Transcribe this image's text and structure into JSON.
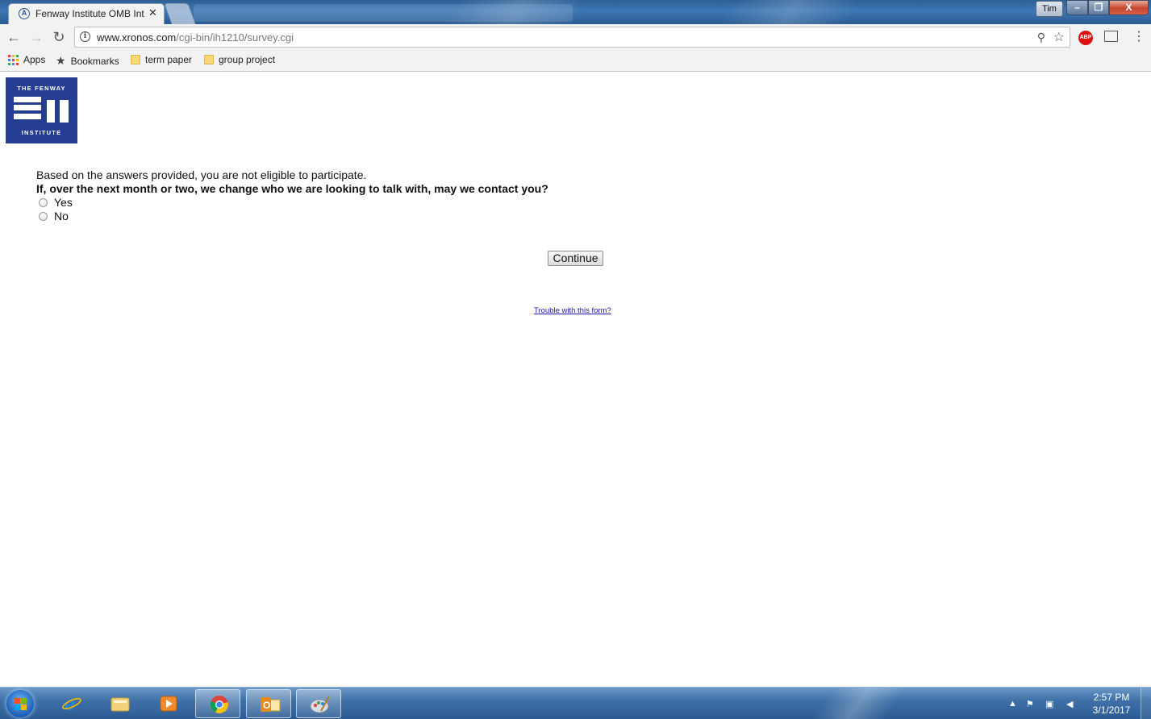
{
  "browser": {
    "active_tab_title": "Fenway Institute OMB Int",
    "tab_close_glyph": "✕",
    "profile_name": "Tim",
    "window_buttons": {
      "minimize": "–",
      "maximize": "❐",
      "close": "X"
    },
    "url_host": "www.xronos.com",
    "url_path": "/cgi-bin/ih1210/survey.cgi",
    "extension_abp": "ABP",
    "icons": [
      "back-icon",
      "forward-icon",
      "reload-icon",
      "info-icon",
      "zoom-icon",
      "bookmark-star-icon",
      "adblock-icon",
      "cast-icon",
      "menu-icon"
    ]
  },
  "bookmarks": [
    {
      "label": "Apps",
      "icon": "apps-grid-icon"
    },
    {
      "label": "Bookmarks",
      "icon": "star-icon"
    },
    {
      "label": "term paper",
      "icon": "folder-icon"
    },
    {
      "label": "group project",
      "icon": "folder-icon"
    }
  ],
  "logo": {
    "line1": "THE FENWAY",
    "line2": "INSTITUTE",
    "brand_color": "#253d93"
  },
  "survey": {
    "message": "Based on the answers provided, you are not eligible to participate.",
    "question": "If, over the next month or two, we change who we are looking to talk with, may we contact you?",
    "options": [
      "Yes",
      "No"
    ],
    "continue_label": "Continue",
    "help_link": "Trouble with this form?"
  },
  "taskbar": {
    "apps": [
      "internet-explorer-icon",
      "file-explorer-icon",
      "media-player-icon",
      "chrome-icon",
      "outlook-icon",
      "paint-icon"
    ],
    "time": "2:57 PM",
    "date": "3/1/2017"
  }
}
